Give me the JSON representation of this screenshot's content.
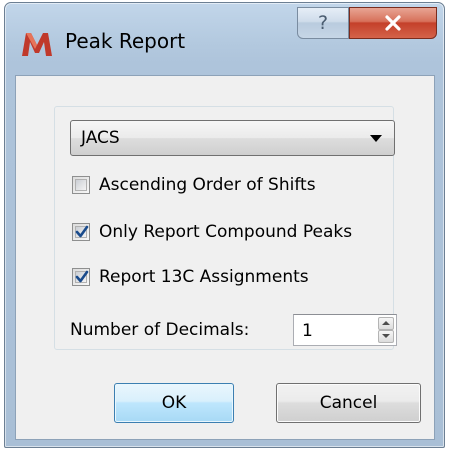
{
  "window": {
    "title": "Peak Report",
    "help_label": "?"
  },
  "form": {
    "journal_select": {
      "selected": "JACS"
    },
    "options": [
      {
        "label": "Ascending Order of Shifts",
        "checked": false
      },
      {
        "label": "Only Report Compound Peaks",
        "checked": true
      },
      {
        "label": "Report 13C Assignments",
        "checked": true
      }
    ],
    "decimals": {
      "label": "Number of Decimals:",
      "value": "1"
    }
  },
  "buttons": {
    "ok": "OK",
    "cancel": "Cancel"
  },
  "icons": {
    "app": "mnova-m-icon",
    "help": "help-icon",
    "close": "close-icon",
    "dropdown": "chevron-down-icon",
    "check": "checkmark-icon"
  },
  "colors": {
    "close_button": "#c4402a",
    "default_button_border": "#3c7fb1",
    "check_mark": "#1a4b8c",
    "app_icon": "#c0392b"
  }
}
